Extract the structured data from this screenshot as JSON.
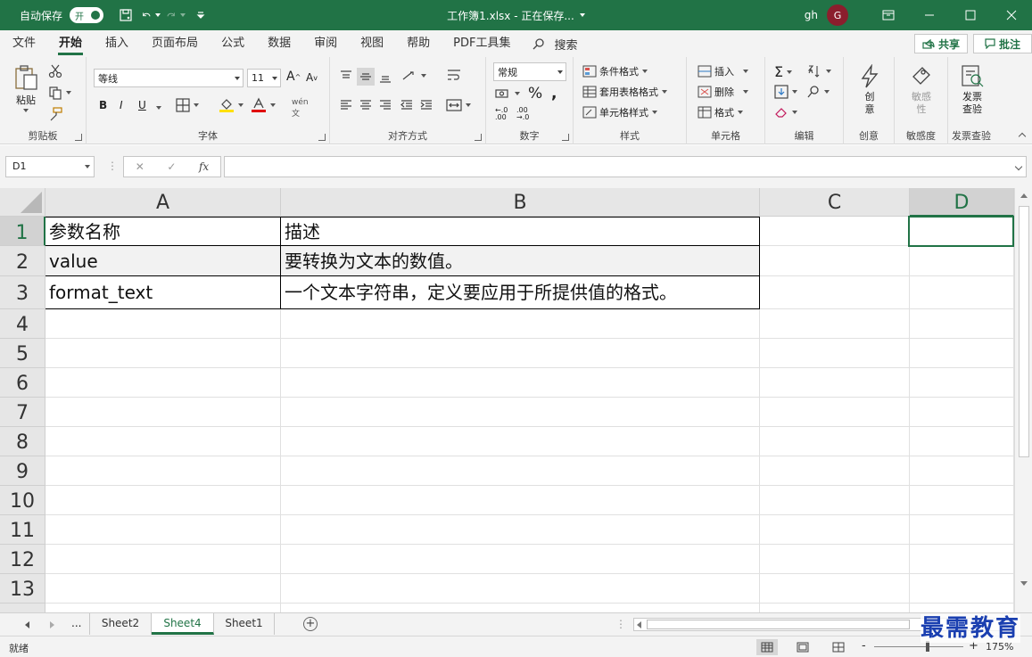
{
  "titlebar": {
    "autosave_label": "自动保存",
    "autosave_state": "开",
    "title": "工作簿1.xlsx - 正在保存...",
    "user_name": "gh",
    "avatar_initial": "G",
    "accent_color": "#217346"
  },
  "menu": {
    "tabs": [
      "文件",
      "开始",
      "插入",
      "页面布局",
      "公式",
      "数据",
      "审阅",
      "视图",
      "帮助",
      "PDF工具集"
    ],
    "active_tab": "开始",
    "search_label": "搜索",
    "share_label": "共享",
    "comment_label": "批注"
  },
  "ribbon": {
    "clipboard": {
      "label": "剪贴板",
      "paste": "粘贴"
    },
    "font": {
      "label": "字体",
      "font_name": "等线",
      "font_size": "11",
      "bold": "B",
      "italic": "I",
      "underline": "U"
    },
    "alignment": {
      "label": "对齐方式"
    },
    "number": {
      "label": "数字",
      "format": "常规"
    },
    "styles": {
      "label": "样式",
      "conditional": "条件格式",
      "table": "套用表格格式",
      "cell_styles": "单元格样式"
    },
    "cells": {
      "label": "单元格",
      "insert": "插入",
      "delete": "删除",
      "format": "格式"
    },
    "editing": {
      "label": "编辑"
    },
    "creativity": {
      "label": "创意",
      "button": "创意"
    },
    "sensitivity": {
      "label": "敏感度",
      "button": "敏感性"
    },
    "invoice": {
      "label": "发票查验",
      "button": "发票查验"
    }
  },
  "formula_bar": {
    "name_box": "D1",
    "fx": "fx",
    "formula": ""
  },
  "grid": {
    "columns": [
      "A",
      "B",
      "C",
      "D"
    ],
    "selected_column": "D",
    "rows": [
      "1",
      "2",
      "3",
      "4",
      "5",
      "6",
      "7",
      "8",
      "9",
      "10",
      "11",
      "12",
      "13"
    ],
    "selected_row": "1",
    "cells": {
      "A1": "参数名称",
      "B1": "描述",
      "A2": "value",
      "B2": "要转换为文本的数值。",
      "A3": "format_text",
      "B3": "一个文本字符串，定义要应用于所提供值的格式。"
    }
  },
  "sheets": {
    "ellipsis": "...",
    "tabs": [
      "Sheet2",
      "Sheet4",
      "Sheet1"
    ],
    "active": "Sheet4",
    "add": "+"
  },
  "status": {
    "ready": "就绪",
    "zoom": "175%"
  },
  "watermark": "最需教育"
}
